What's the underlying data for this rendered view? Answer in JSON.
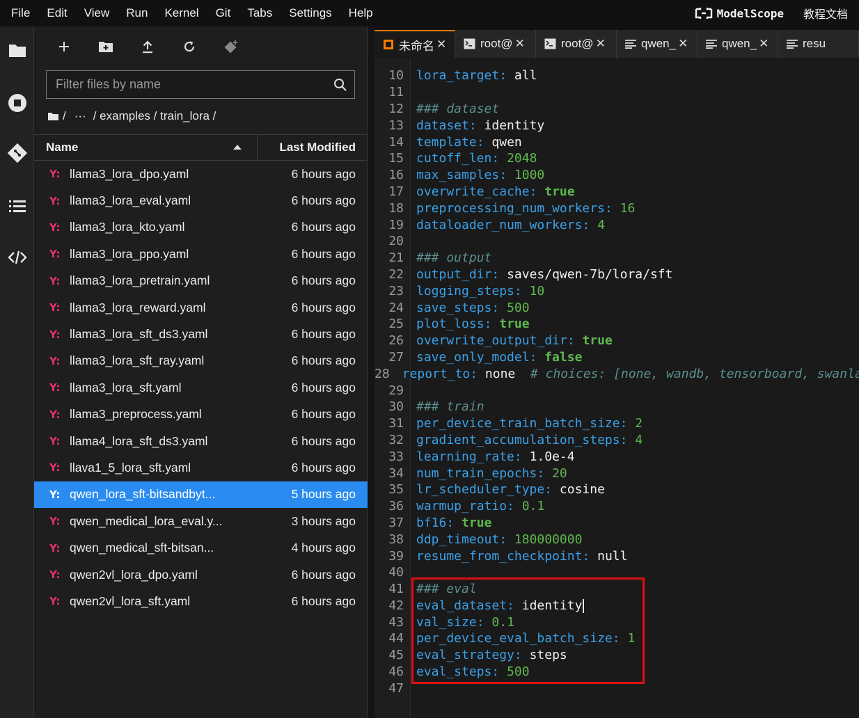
{
  "menubar": {
    "items": [
      "File",
      "Edit",
      "View",
      "Run",
      "Kernel",
      "Git",
      "Tabs",
      "Settings",
      "Help"
    ],
    "brand": "ModelScope",
    "doc_link": "教程文档"
  },
  "filebrowser": {
    "filter_placeholder": "Filter files by name",
    "breadcrumb": {
      "root": "/",
      "ellipsis": "···",
      "path": "/ examples / train_lora /"
    },
    "header": {
      "name": "Name",
      "modified": "Last Modified"
    },
    "files": [
      {
        "name": "llama3_lora_dpo.yaml",
        "modified": "6 hours ago"
      },
      {
        "name": "llama3_lora_eval.yaml",
        "modified": "6 hours ago"
      },
      {
        "name": "llama3_lora_kto.yaml",
        "modified": "6 hours ago"
      },
      {
        "name": "llama3_lora_ppo.yaml",
        "modified": "6 hours ago"
      },
      {
        "name": "llama3_lora_pretrain.yaml",
        "modified": "6 hours ago"
      },
      {
        "name": "llama3_lora_reward.yaml",
        "modified": "6 hours ago"
      },
      {
        "name": "llama3_lora_sft_ds3.yaml",
        "modified": "6 hours ago"
      },
      {
        "name": "llama3_lora_sft_ray.yaml",
        "modified": "6 hours ago"
      },
      {
        "name": "llama3_lora_sft.yaml",
        "modified": "6 hours ago"
      },
      {
        "name": "llama3_preprocess.yaml",
        "modified": "6 hours ago"
      },
      {
        "name": "llama4_lora_sft_ds3.yaml",
        "modified": "6 hours ago"
      },
      {
        "name": "llava1_5_lora_sft.yaml",
        "modified": "6 hours ago"
      },
      {
        "name": "qwen_lora_sft-bitsandbyt...",
        "modified": "5 hours ago",
        "selected": true
      },
      {
        "name": "qwen_medical_lora_eval.y...",
        "modified": "3 hours ago"
      },
      {
        "name": "qwen_medical_sft-bitsan...",
        "modified": "4 hours ago"
      },
      {
        "name": "qwen2vl_lora_dpo.yaml",
        "modified": "6 hours ago"
      },
      {
        "name": "qwen2vl_lora_sft.yaml",
        "modified": "6 hours ago"
      }
    ],
    "file_icon": "Y:"
  },
  "tabs": [
    {
      "label": "未命名",
      "icon": "notebook-icon",
      "active": true
    },
    {
      "label": "root@",
      "icon": "terminal-icon"
    },
    {
      "label": "root@",
      "icon": "terminal-icon"
    },
    {
      "label": "qwen_",
      "icon": "text-file-icon"
    },
    {
      "label": "qwen_",
      "icon": "text-file-icon"
    },
    {
      "label": "resu",
      "icon": "text-file-icon"
    }
  ],
  "editor": {
    "lines": [
      {
        "n": "10",
        "key": "lora_target",
        "val": "all",
        "type": "str"
      },
      {
        "n": "11"
      },
      {
        "n": "12",
        "comment": "### dataset"
      },
      {
        "n": "13",
        "key": "dataset",
        "val": "identity",
        "type": "str"
      },
      {
        "n": "14",
        "key": "template",
        "val": "qwen",
        "type": "str"
      },
      {
        "n": "15",
        "key": "cutoff_len",
        "val": "2048",
        "type": "num"
      },
      {
        "n": "16",
        "key": "max_samples",
        "val": "1000",
        "type": "num"
      },
      {
        "n": "17",
        "key": "overwrite_cache",
        "val": "true",
        "type": "bool"
      },
      {
        "n": "18",
        "key": "preprocessing_num_workers",
        "val": "16",
        "type": "num"
      },
      {
        "n": "19",
        "key": "dataloader_num_workers",
        "val": "4",
        "type": "num"
      },
      {
        "n": "20"
      },
      {
        "n": "21",
        "comment": "### output"
      },
      {
        "n": "22",
        "key": "output_dir",
        "val": "saves/qwen-7b/lora/sft",
        "type": "str"
      },
      {
        "n": "23",
        "key": "logging_steps",
        "val": "10",
        "type": "num"
      },
      {
        "n": "24",
        "key": "save_steps",
        "val": "500",
        "type": "num"
      },
      {
        "n": "25",
        "key": "plot_loss",
        "val": "true",
        "type": "bool"
      },
      {
        "n": "26",
        "key": "overwrite_output_dir",
        "val": "true",
        "type": "bool"
      },
      {
        "n": "27",
        "key": "save_only_model",
        "val": "false",
        "type": "bool"
      },
      {
        "n": "28",
        "key": "report_to",
        "val": "none",
        "type": "str",
        "trail": "  # choices: [none, wandb, tensorboard, swanlab, mlflow]"
      },
      {
        "n": "29"
      },
      {
        "n": "30",
        "comment": "### train"
      },
      {
        "n": "31",
        "key": "per_device_train_batch_size",
        "val": "2",
        "type": "num"
      },
      {
        "n": "32",
        "key": "gradient_accumulation_steps",
        "val": "4",
        "type": "num"
      },
      {
        "n": "33",
        "key": "learning_rate",
        "val": "1.0e-4",
        "type": "str"
      },
      {
        "n": "34",
        "key": "num_train_epochs",
        "val": "20",
        "type": "num"
      },
      {
        "n": "35",
        "key": "lr_scheduler_type",
        "val": "cosine",
        "type": "str"
      },
      {
        "n": "36",
        "key": "warmup_ratio",
        "val": "0.1",
        "type": "num"
      },
      {
        "n": "37",
        "key": "bf16",
        "val": "true",
        "type": "bool"
      },
      {
        "n": "38",
        "key": "ddp_timeout",
        "val": "180000000",
        "type": "num"
      },
      {
        "n": "39",
        "key": "resume_from_checkpoint",
        "val": "null",
        "type": "str"
      },
      {
        "n": "40"
      },
      {
        "n": "41",
        "comment": "### eval"
      },
      {
        "n": "42",
        "key": "eval_dataset",
        "val": "identity",
        "type": "str",
        "cursor": true
      },
      {
        "n": "43",
        "key": "val_size",
        "val": "0.1",
        "type": "num"
      },
      {
        "n": "44",
        "key": "per_device_eval_batch_size",
        "val": "1",
        "type": "num"
      },
      {
        "n": "45",
        "key": "eval_strategy",
        "val": "steps",
        "type": "str"
      },
      {
        "n": "46",
        "key": "eval_steps",
        "val": "500",
        "type": "num"
      },
      {
        "n": "47"
      }
    ]
  },
  "colors": {
    "accent": "#2a8cf0",
    "yaml_icon": "#e3326e",
    "key": "#3aa0e8",
    "number": "#5fb84e",
    "comment": "#5b8f8f",
    "highlight": "#e01010",
    "active_tab": "#f57c00"
  }
}
